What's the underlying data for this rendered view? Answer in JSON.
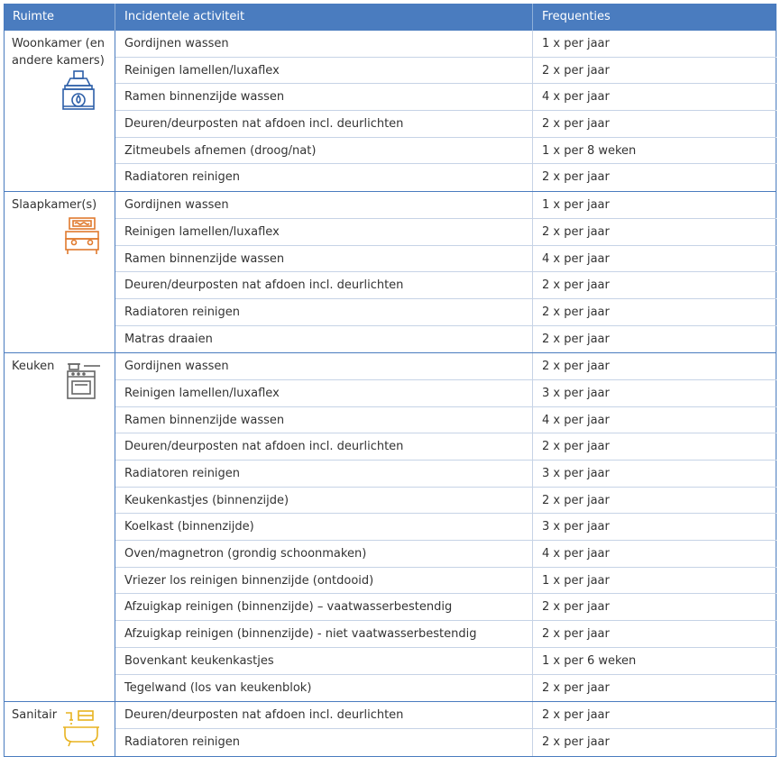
{
  "header": {
    "col_room": "Ruimte",
    "col_activity": "Incidentele activiteit",
    "col_frequency": "Frequenties"
  },
  "groups": [
    {
      "room": "Woonkamer (en andere kamers)",
      "icon": "fireplace-icon",
      "icon_color": "#2d5fa8",
      "rows": [
        {
          "activity": "Gordijnen wassen",
          "frequency": "1 x per jaar"
        },
        {
          "activity": "Reinigen lamellen/luxaflex",
          "frequency": "2 x per jaar"
        },
        {
          "activity": "Ramen binnenzijde wassen",
          "frequency": "4 x per jaar"
        },
        {
          "activity": "Deuren/deurposten nat afdoen incl. deurlichten",
          "frequency": "2 x per jaar"
        },
        {
          "activity": "Zitmeubels afnemen (droog/nat)",
          "frequency": "1 x per 8 weken"
        },
        {
          "activity": "Radiatoren reinigen",
          "frequency": "2 x per jaar"
        }
      ]
    },
    {
      "room": "Slaapkamer(s)",
      "icon": "bed-icon",
      "icon_color": "#e07a2e",
      "rows": [
        {
          "activity": "Gordijnen wassen",
          "frequency": "1 x per jaar"
        },
        {
          "activity": "Reinigen lamellen/luxaflex",
          "frequency": "2 x per jaar"
        },
        {
          "activity": "Ramen binnenzijde wassen",
          "frequency": "4 x per jaar"
        },
        {
          "activity": "Deuren/deurposten nat afdoen incl. deurlichten",
          "frequency": "2 x per jaar"
        },
        {
          "activity": "Radiatoren reinigen",
          "frequency": "2 x per jaar"
        },
        {
          "activity": "Matras draaien",
          "frequency": "2 x per jaar"
        }
      ]
    },
    {
      "room": "Keuken",
      "icon": "stove-icon",
      "icon_color": "#666666",
      "rows": [
        {
          "activity": "Gordijnen wassen",
          "frequency": "2 x per jaar"
        },
        {
          "activity": "Reinigen lamellen/luxaflex",
          "frequency": "3 x per jaar"
        },
        {
          "activity": "Ramen binnenzijde wassen",
          "frequency": "4 x per jaar"
        },
        {
          "activity": "Deuren/deurposten nat afdoen incl. deurlichten",
          "frequency": "2 x per jaar"
        },
        {
          "activity": "Radiatoren reinigen",
          "frequency": "3 x per jaar"
        },
        {
          "activity": "Keukenkastjes (binnenzijde)",
          "frequency": "2 x per jaar"
        },
        {
          "activity": "Koelkast (binnenzijde)",
          "frequency": "3 x per jaar"
        },
        {
          "activity": "Oven/magnetron (grondig schoonmaken)",
          "frequency": "4 x per jaar"
        },
        {
          "activity": "Vriezer los reinigen binnenzijde (ontdooid)",
          "frequency": "1 x per jaar"
        },
        {
          "activity": "Afzuigkap reinigen (binnenzijde) – vaatwasserbestendig",
          "frequency": "2 x per jaar"
        },
        {
          "activity": "Afzuigkap reinigen (binnenzijde) - niet vaatwasserbestendig",
          "frequency": "2 x per jaar"
        },
        {
          "activity": "Bovenkant keukenkastjes",
          "frequency": "1 x per 6 weken"
        },
        {
          "activity": "Tegelwand (los van keukenblok)",
          "frequency": "2 x per jaar"
        }
      ]
    },
    {
      "room": "Sanitair",
      "icon": "bathtub-icon",
      "icon_color": "#e8b320",
      "rows": [
        {
          "activity": "Deuren/deurposten nat afdoen incl. deurlichten",
          "frequency": "2 x per jaar"
        },
        {
          "activity": "Radiatoren reinigen",
          "frequency": "2 x per jaar"
        }
      ]
    }
  ]
}
